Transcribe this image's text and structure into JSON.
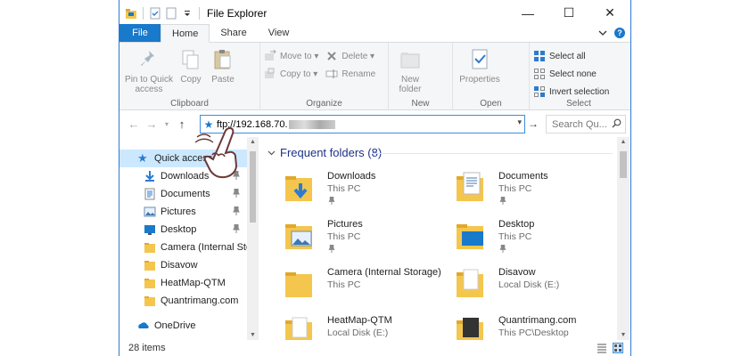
{
  "window": {
    "title": "File Explorer",
    "controls": {
      "minimize": "—",
      "maximize": "☐",
      "close": "✕"
    }
  },
  "ribbon_tabs": {
    "file": "File",
    "home": "Home",
    "share": "Share",
    "view": "View"
  },
  "ribbon": {
    "clipboard": {
      "label": "Clipboard",
      "pin_quick_access": "Pin to Quick access",
      "copy": "Copy",
      "paste": "Paste"
    },
    "organize": {
      "label": "Organize",
      "move_to": "Move to ▾",
      "copy_to": "Copy to ▾",
      "delete": "Delete ▾",
      "rename": "Rename"
    },
    "new": {
      "label": "New",
      "new_folder": "New folder"
    },
    "open": {
      "label": "Open",
      "properties": "Properties"
    },
    "select": {
      "label": "Select",
      "select_all": "Select all",
      "select_none": "Select none",
      "invert_selection": "Invert selection"
    }
  },
  "address": {
    "path": "ftp://192.168.70."
  },
  "search": {
    "placeholder": "Search Qu..."
  },
  "nav": {
    "quick_access": "Quick access",
    "items": [
      {
        "label": "Downloads",
        "icon": "download-icon",
        "pinned": true
      },
      {
        "label": "Documents",
        "icon": "document-icon",
        "pinned": true
      },
      {
        "label": "Pictures",
        "icon": "picture-icon",
        "pinned": true
      },
      {
        "label": "Desktop",
        "icon": "desktop-icon",
        "pinned": true
      },
      {
        "label": "Camera (Internal Storage)",
        "icon": "folder-icon",
        "pinned": false
      },
      {
        "label": "Disavow",
        "icon": "folder-icon",
        "pinned": false
      },
      {
        "label": "HeatMap-QTM",
        "icon": "folder-icon",
        "pinned": false
      },
      {
        "label": "Quantrimang.com",
        "icon": "folder-icon",
        "pinned": false
      }
    ],
    "onedrive": "OneDrive"
  },
  "frequent": {
    "header": "Frequent folders (8)",
    "tiles": [
      {
        "name": "Downloads",
        "location": "This PC",
        "pinned": true,
        "icon": "downloads-folder-icon"
      },
      {
        "name": "Documents",
        "location": "This PC",
        "pinned": true,
        "icon": "documents-folder-icon"
      },
      {
        "name": "Pictures",
        "location": "This PC",
        "pinned": true,
        "icon": "pictures-folder-icon"
      },
      {
        "name": "Desktop",
        "location": "This PC",
        "pinned": true,
        "icon": "desktop-folder-icon"
      },
      {
        "name": "Camera (Internal Storage)",
        "location": "This PC",
        "pinned": false,
        "icon": "folder-icon"
      },
      {
        "name": "Disavow",
        "location": "Local Disk (E:)",
        "pinned": false,
        "icon": "folder-icon"
      },
      {
        "name": "HeatMap-QTM",
        "location": "Local Disk (E:)",
        "pinned": false,
        "icon": "folder-icon"
      },
      {
        "name": "Quantrimang.com",
        "location": "This PC\\Desktop",
        "pinned": false,
        "icon": "folder-icon"
      }
    ]
  },
  "status": {
    "items": "28 items"
  },
  "colors": {
    "accent": "#1979ca",
    "folder": "#f4c64e",
    "selection": "#cce8ff"
  }
}
